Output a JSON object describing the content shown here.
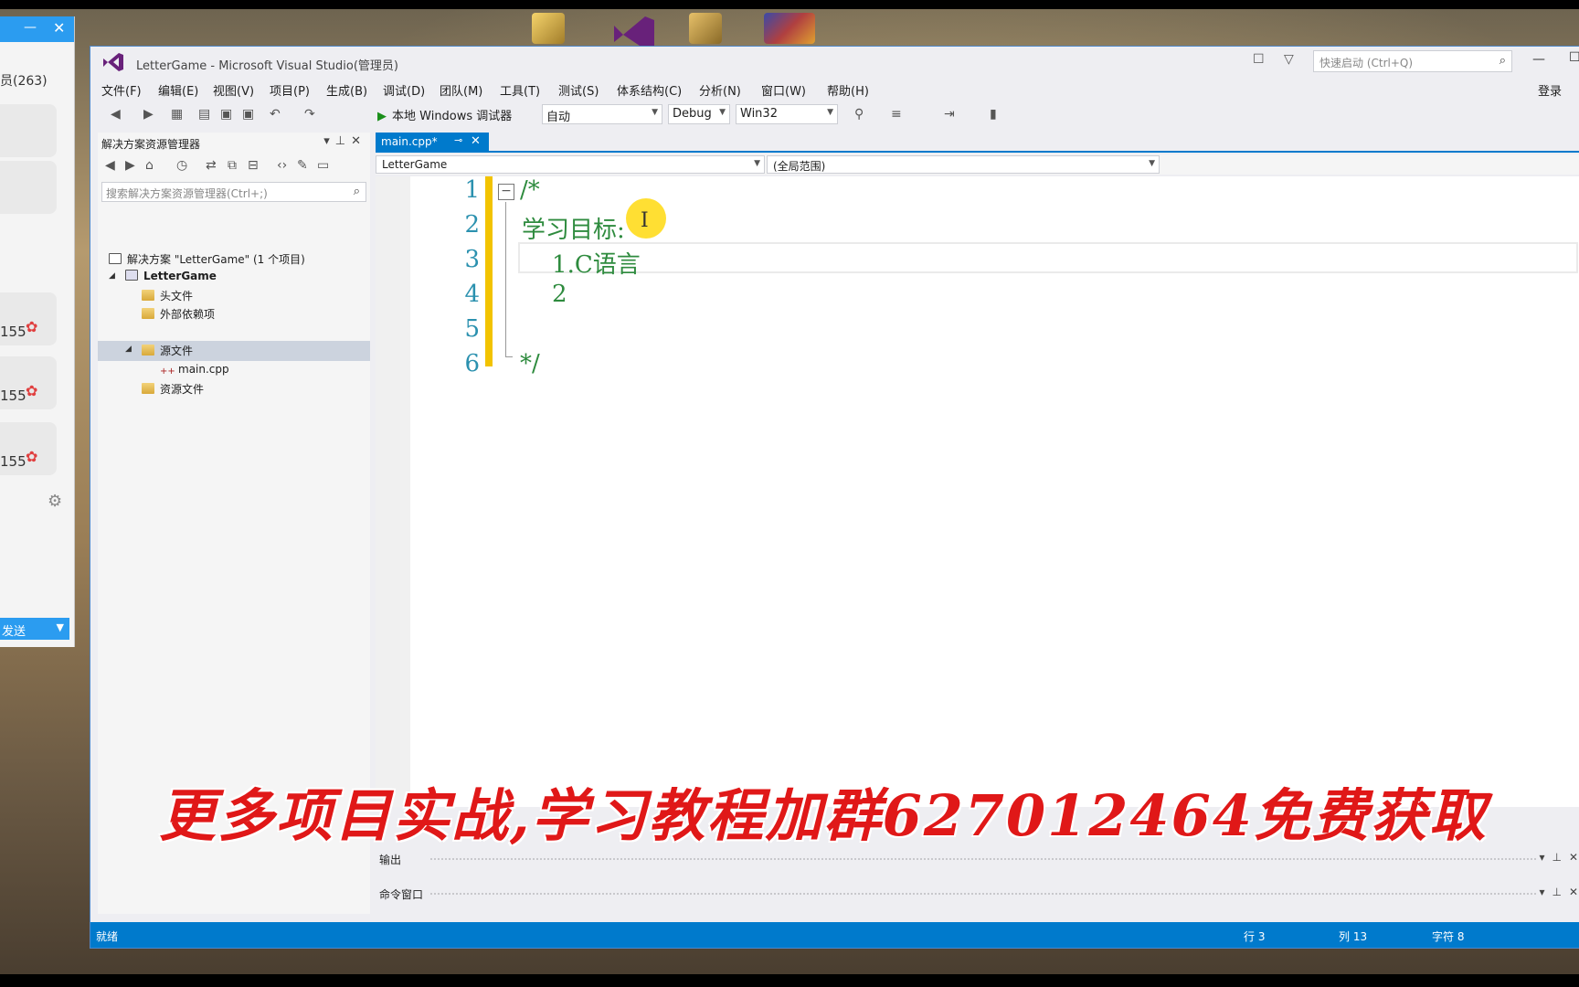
{
  "chat": {
    "members": "员(263)",
    "stats": [
      "155",
      "155",
      "155"
    ],
    "send_label": "发送"
  },
  "vs": {
    "title": "LetterGame - Microsoft Visual Studio(管理员)",
    "quick_launch_placeholder": "快速启动 (Ctrl+Q)",
    "login": "登录",
    "menu": [
      "文件(F)",
      "编辑(E)",
      "视图(V)",
      "项目(P)",
      "生成(B)",
      "调试(D)",
      "团队(M)",
      "工具(T)",
      "测试(S)",
      "体系结构(C)",
      "分析(N)",
      "窗口(W)",
      "帮助(H)"
    ],
    "toolbar": {
      "run_label": "本地 Windows 调试器",
      "auto": "自动",
      "config": "Debug",
      "platform": "Win32"
    }
  },
  "solution_explorer": {
    "title": "解决方案资源管理器",
    "search_placeholder": "搜索解决方案资源管理器(Ctrl+;)",
    "tree": {
      "solution": "解决方案 \"LetterGame\" (1 个项目)",
      "project": "LetterGame",
      "headers": "头文件",
      "external": "外部依赖项",
      "sources": "源文件",
      "main_cpp": "main.cpp",
      "resources": "资源文件"
    }
  },
  "editor": {
    "tab_label": "main.cpp*",
    "nav_left": "LetterGame",
    "nav_right": "(全局范围)",
    "line_numbers": [
      "1",
      "2",
      "3",
      "4",
      "5",
      "6"
    ],
    "lines": [
      "/*",
      "学习目标:",
      "    1.C语言",
      "    2",
      "",
      "*/"
    ]
  },
  "panels": {
    "output": "输出",
    "command": "命令窗口"
  },
  "status": {
    "ready": "就绪",
    "row": "行 3",
    "col": "列 13",
    "char": "字符 8"
  },
  "watermark": "更多项目实战,学习教程加群627012464免费获取",
  "colors": {
    "accent": "#007acc",
    "comment": "#2e8b3e",
    "line_number": "#2b91af",
    "watermark": "#e01818"
  }
}
